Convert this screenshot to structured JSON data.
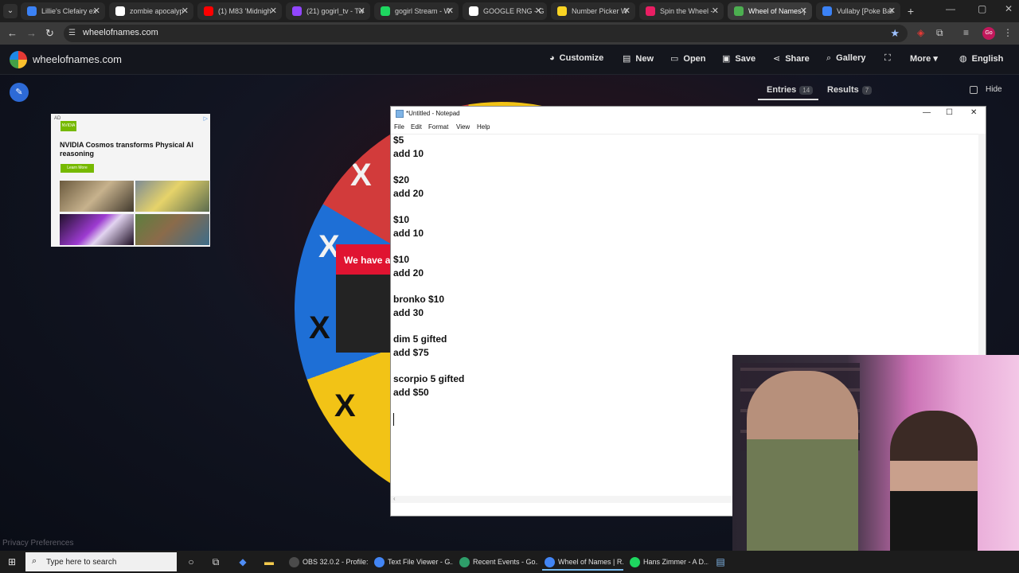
{
  "browser": {
    "tabs": [
      {
        "title": "Lillie's Clefairy ex",
        "color": "#3b82f6"
      },
      {
        "title": "zombie apocalyp",
        "color": "#ffffff"
      },
      {
        "title": "(1) M83 'Midnigh",
        "color": "#ff0000"
      },
      {
        "title": "(21) gogirl_tv - Tw",
        "color": "#9146ff"
      },
      {
        "title": "gogirl Stream - W",
        "color": "#1ed760"
      },
      {
        "title": "GOOGLE RNG - G",
        "color": "#ffffff"
      },
      {
        "title": "Number Picker W",
        "color": "#f9d423"
      },
      {
        "title": "Spin the Wheel -",
        "color": "#e91e63"
      },
      {
        "title": "Wheel of Names |",
        "color": "#4caf50"
      },
      {
        "title": "Vullaby [Poke Bal",
        "color": "#3b82f6"
      }
    ],
    "url": "wheelofnames.com"
  },
  "site": {
    "logo_text": "wheelofnames.com",
    "nav": {
      "customize": "Customize",
      "new": "New",
      "open": "Open",
      "save": "Save",
      "share": "Share",
      "gallery": "Gallery",
      "more": "More",
      "language": "English"
    },
    "panel": {
      "entries_label": "Entries",
      "entries_count": "14",
      "results_label": "Results",
      "results_count": "7",
      "hide_label": "Hide"
    },
    "popup_text": "We have a",
    "privacy": "Privacy Preferences"
  },
  "ad": {
    "tag": "AD",
    "brand": "NVIDIA",
    "headline": "NVIDIA Cosmos transforms Physical AI reasoning",
    "cta": "Learn More"
  },
  "notepad": {
    "title": "*Untitled - Notepad",
    "menu": [
      "File",
      "Edit",
      "Format",
      "View",
      "Help"
    ],
    "lines": [
      "$5",
      "add 10",
      "",
      "$20",
      "add 20",
      "",
      "$10",
      "add 10",
      "",
      "$10",
      "add 20",
      "",
      "bronko $10",
      "add 30",
      "",
      "dim 5 gifted",
      "add $75",
      "",
      "scorpio 5 gifted",
      "add $50"
    ]
  },
  "taskbar": {
    "search_placeholder": "Type here to search",
    "apps": [
      {
        "label": "OBS 32.0.2 - Profile:...",
        "color": "#4b4b4b"
      },
      {
        "label": "Text File Viewer - G...",
        "color": "#4285f4"
      },
      {
        "label": "Recent Events - Go...",
        "color": "#2e9e6a"
      },
      {
        "label": "Wheel of Names | R...",
        "color": "#4285f4"
      },
      {
        "label": "Hans Zimmer - A D...",
        "color": "#1ed760"
      }
    ]
  }
}
